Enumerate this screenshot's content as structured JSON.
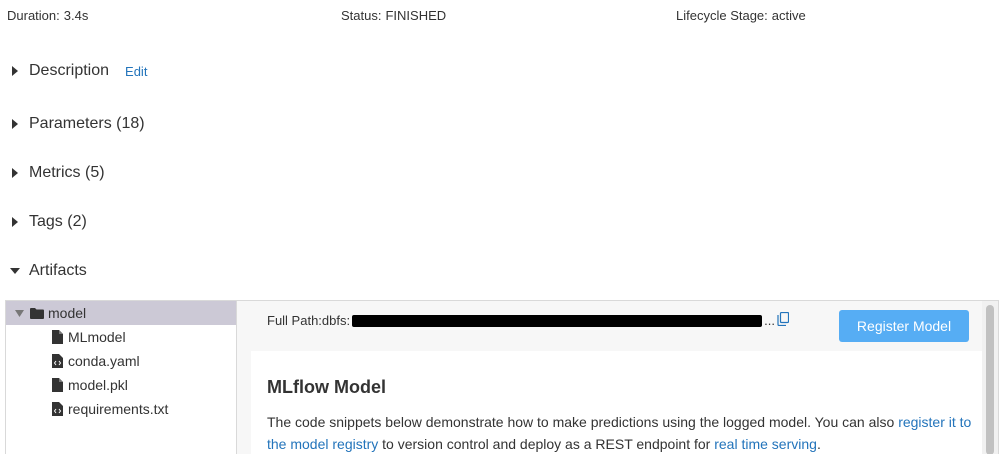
{
  "meta": {
    "duration_label": "Duration:",
    "duration_value": "3.4s",
    "status_label": "Status:",
    "status_value": "FINISHED",
    "lifecycle_label": "Lifecycle Stage:",
    "lifecycle_value": "active"
  },
  "sections": {
    "description": {
      "title": "Description",
      "edit_label": "Edit"
    },
    "parameters": {
      "title": "Parameters (18)"
    },
    "metrics": {
      "title": "Metrics (5)"
    },
    "tags": {
      "title": "Tags (2)"
    },
    "artifacts": {
      "title": "Artifacts"
    }
  },
  "tree": {
    "folder": "model",
    "files": [
      "MLmodel",
      "conda.yaml",
      "model.pkl",
      "requirements.txt"
    ]
  },
  "detail": {
    "full_path_label": "Full Path:dbfs:",
    "full_path_suffix": "...",
    "register_button": "Register Model",
    "title": "MLflow Model",
    "body_text_1": "The code snippets below demonstrate how to make predictions using the logged model. You can also ",
    "body_link_1": "register it to the model registry",
    "body_text_2": " to version control and deploy as a REST endpoint for ",
    "body_link_2": "real time serving",
    "body_text_3": "."
  },
  "colors": {
    "link": "#2374bb",
    "primary_button": "#56adf4",
    "selected_row": "#ccc9d6"
  }
}
